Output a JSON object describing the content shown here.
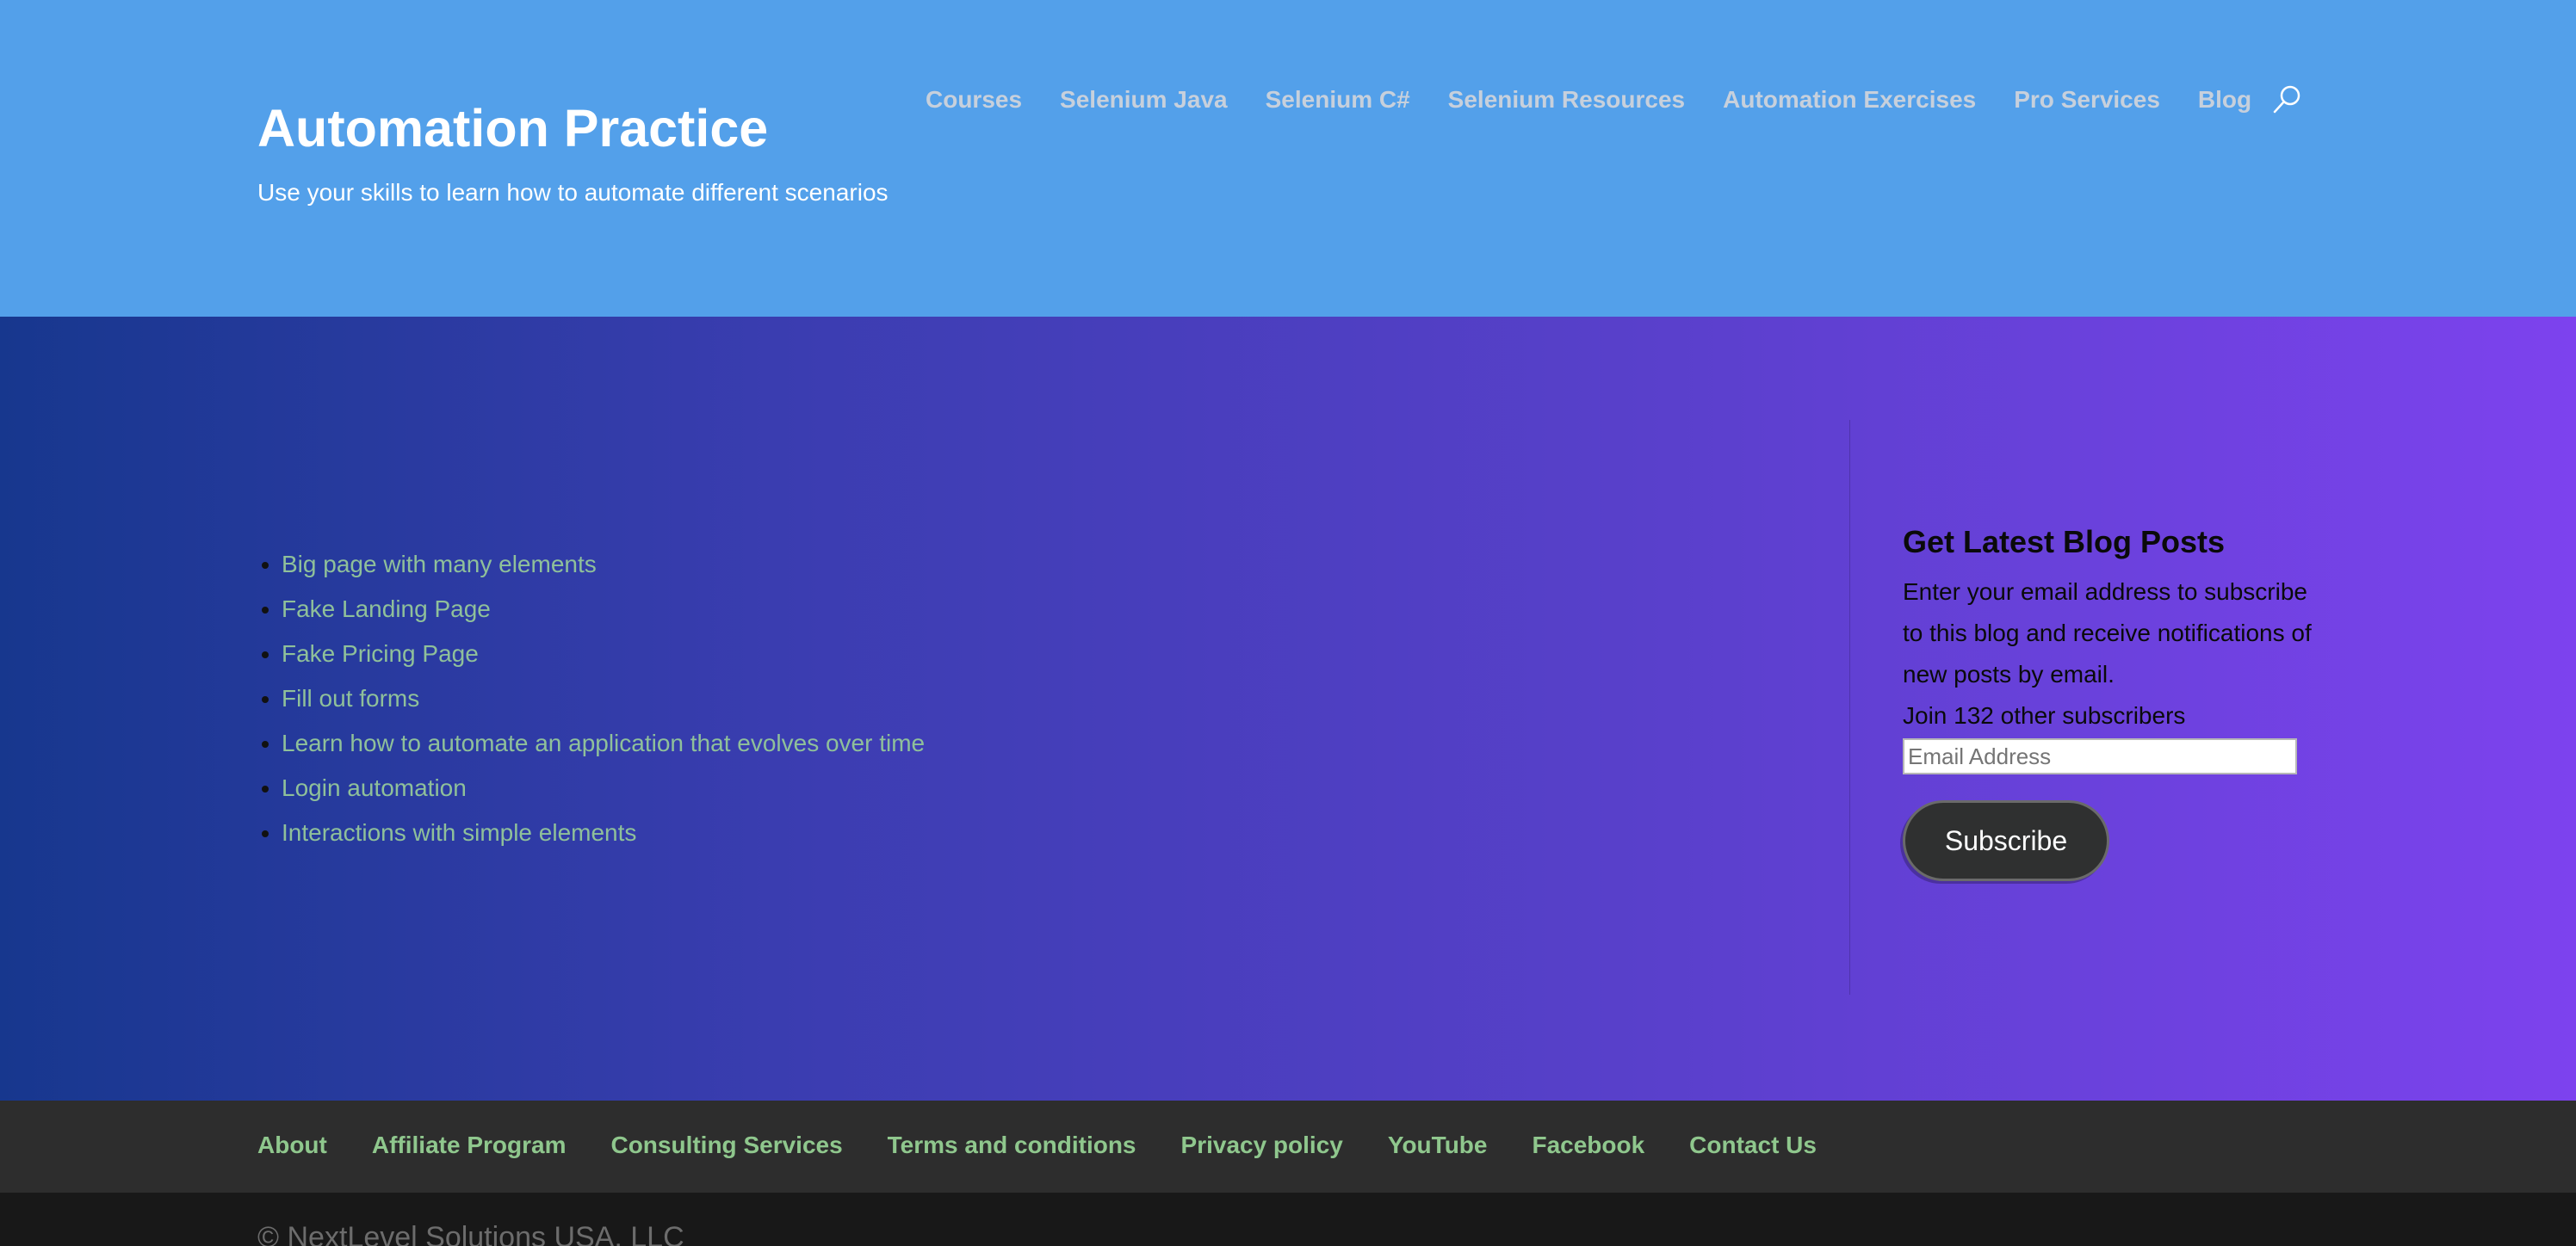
{
  "header": {
    "title": "Automation Practice",
    "tagline": "Use your skills to learn how to automate different scenarios",
    "nav": [
      {
        "label": "Courses"
      },
      {
        "label": "Selenium Java"
      },
      {
        "label": "Selenium C#"
      },
      {
        "label": "Selenium Resources"
      },
      {
        "label": "Automation Exercises"
      },
      {
        "label": "Pro Services"
      },
      {
        "label": "Blog"
      }
    ],
    "search_icon": "search-icon"
  },
  "main": {
    "links": [
      "Big page with many elements",
      "Fake Landing Page",
      "Fake Pricing Page",
      "Fill out forms",
      "Learn how to automate an application that evolves over time",
      "Login automation",
      "Interactions with simple elements"
    ]
  },
  "widget": {
    "title": "Get Latest Blog Posts",
    "description": "Enter your email address to subscribe to this blog and receive notifications of new posts by email.",
    "subscribers": "Join 132 other subscribers",
    "email_placeholder": "Email Address",
    "email_value": "",
    "button_label": "Subscribe"
  },
  "footer": {
    "links": [
      "About",
      "Affiliate Program",
      "Consulting Services",
      "Terms and conditions",
      "Privacy policy",
      "YouTube",
      "Facebook",
      "Contact Us"
    ],
    "copyright": "© NextLevel Solutions USA, LLC"
  },
  "colors": {
    "header_bg": "#53a0ea",
    "gradient_start": "#17378e",
    "gradient_end": "#7d42ee",
    "link_green": "#8fc09a",
    "footer_nav_bg": "#2d2d2d",
    "bottom_bar_bg": "#181818",
    "button_bg": "#2f3030"
  }
}
